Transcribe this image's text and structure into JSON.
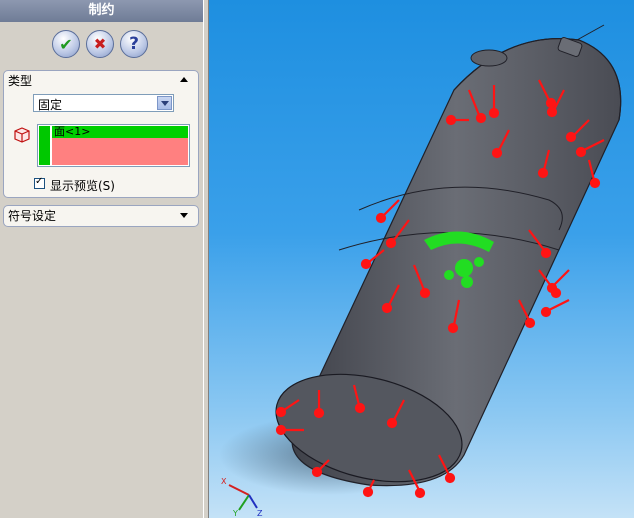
{
  "panel": {
    "title": "制约",
    "actions": [
      {
        "name": "ok",
        "glyph": "✔",
        "color": "#1f9a1f"
      },
      {
        "name": "cancel",
        "glyph": "✖",
        "color": "#c81e1e"
      },
      {
        "name": "help",
        "glyph": "?",
        "color": "#2a3f9a"
      }
    ]
  },
  "type_group": {
    "title": "类型",
    "select_value": "固定",
    "face_item": "面<1>",
    "preview_label": "显示预览(S)",
    "preview_checked": true
  },
  "symbol_group": {
    "title": "符号设定"
  },
  "colors": {
    "vessel": "#5b5e66",
    "load_arrow": "#ff1414",
    "fixture": "#22dd22",
    "selected_face": "#00d000",
    "selected_face_pink": "#ff8080"
  },
  "triad": {
    "x": "X",
    "y": "Y",
    "z": "Z"
  }
}
